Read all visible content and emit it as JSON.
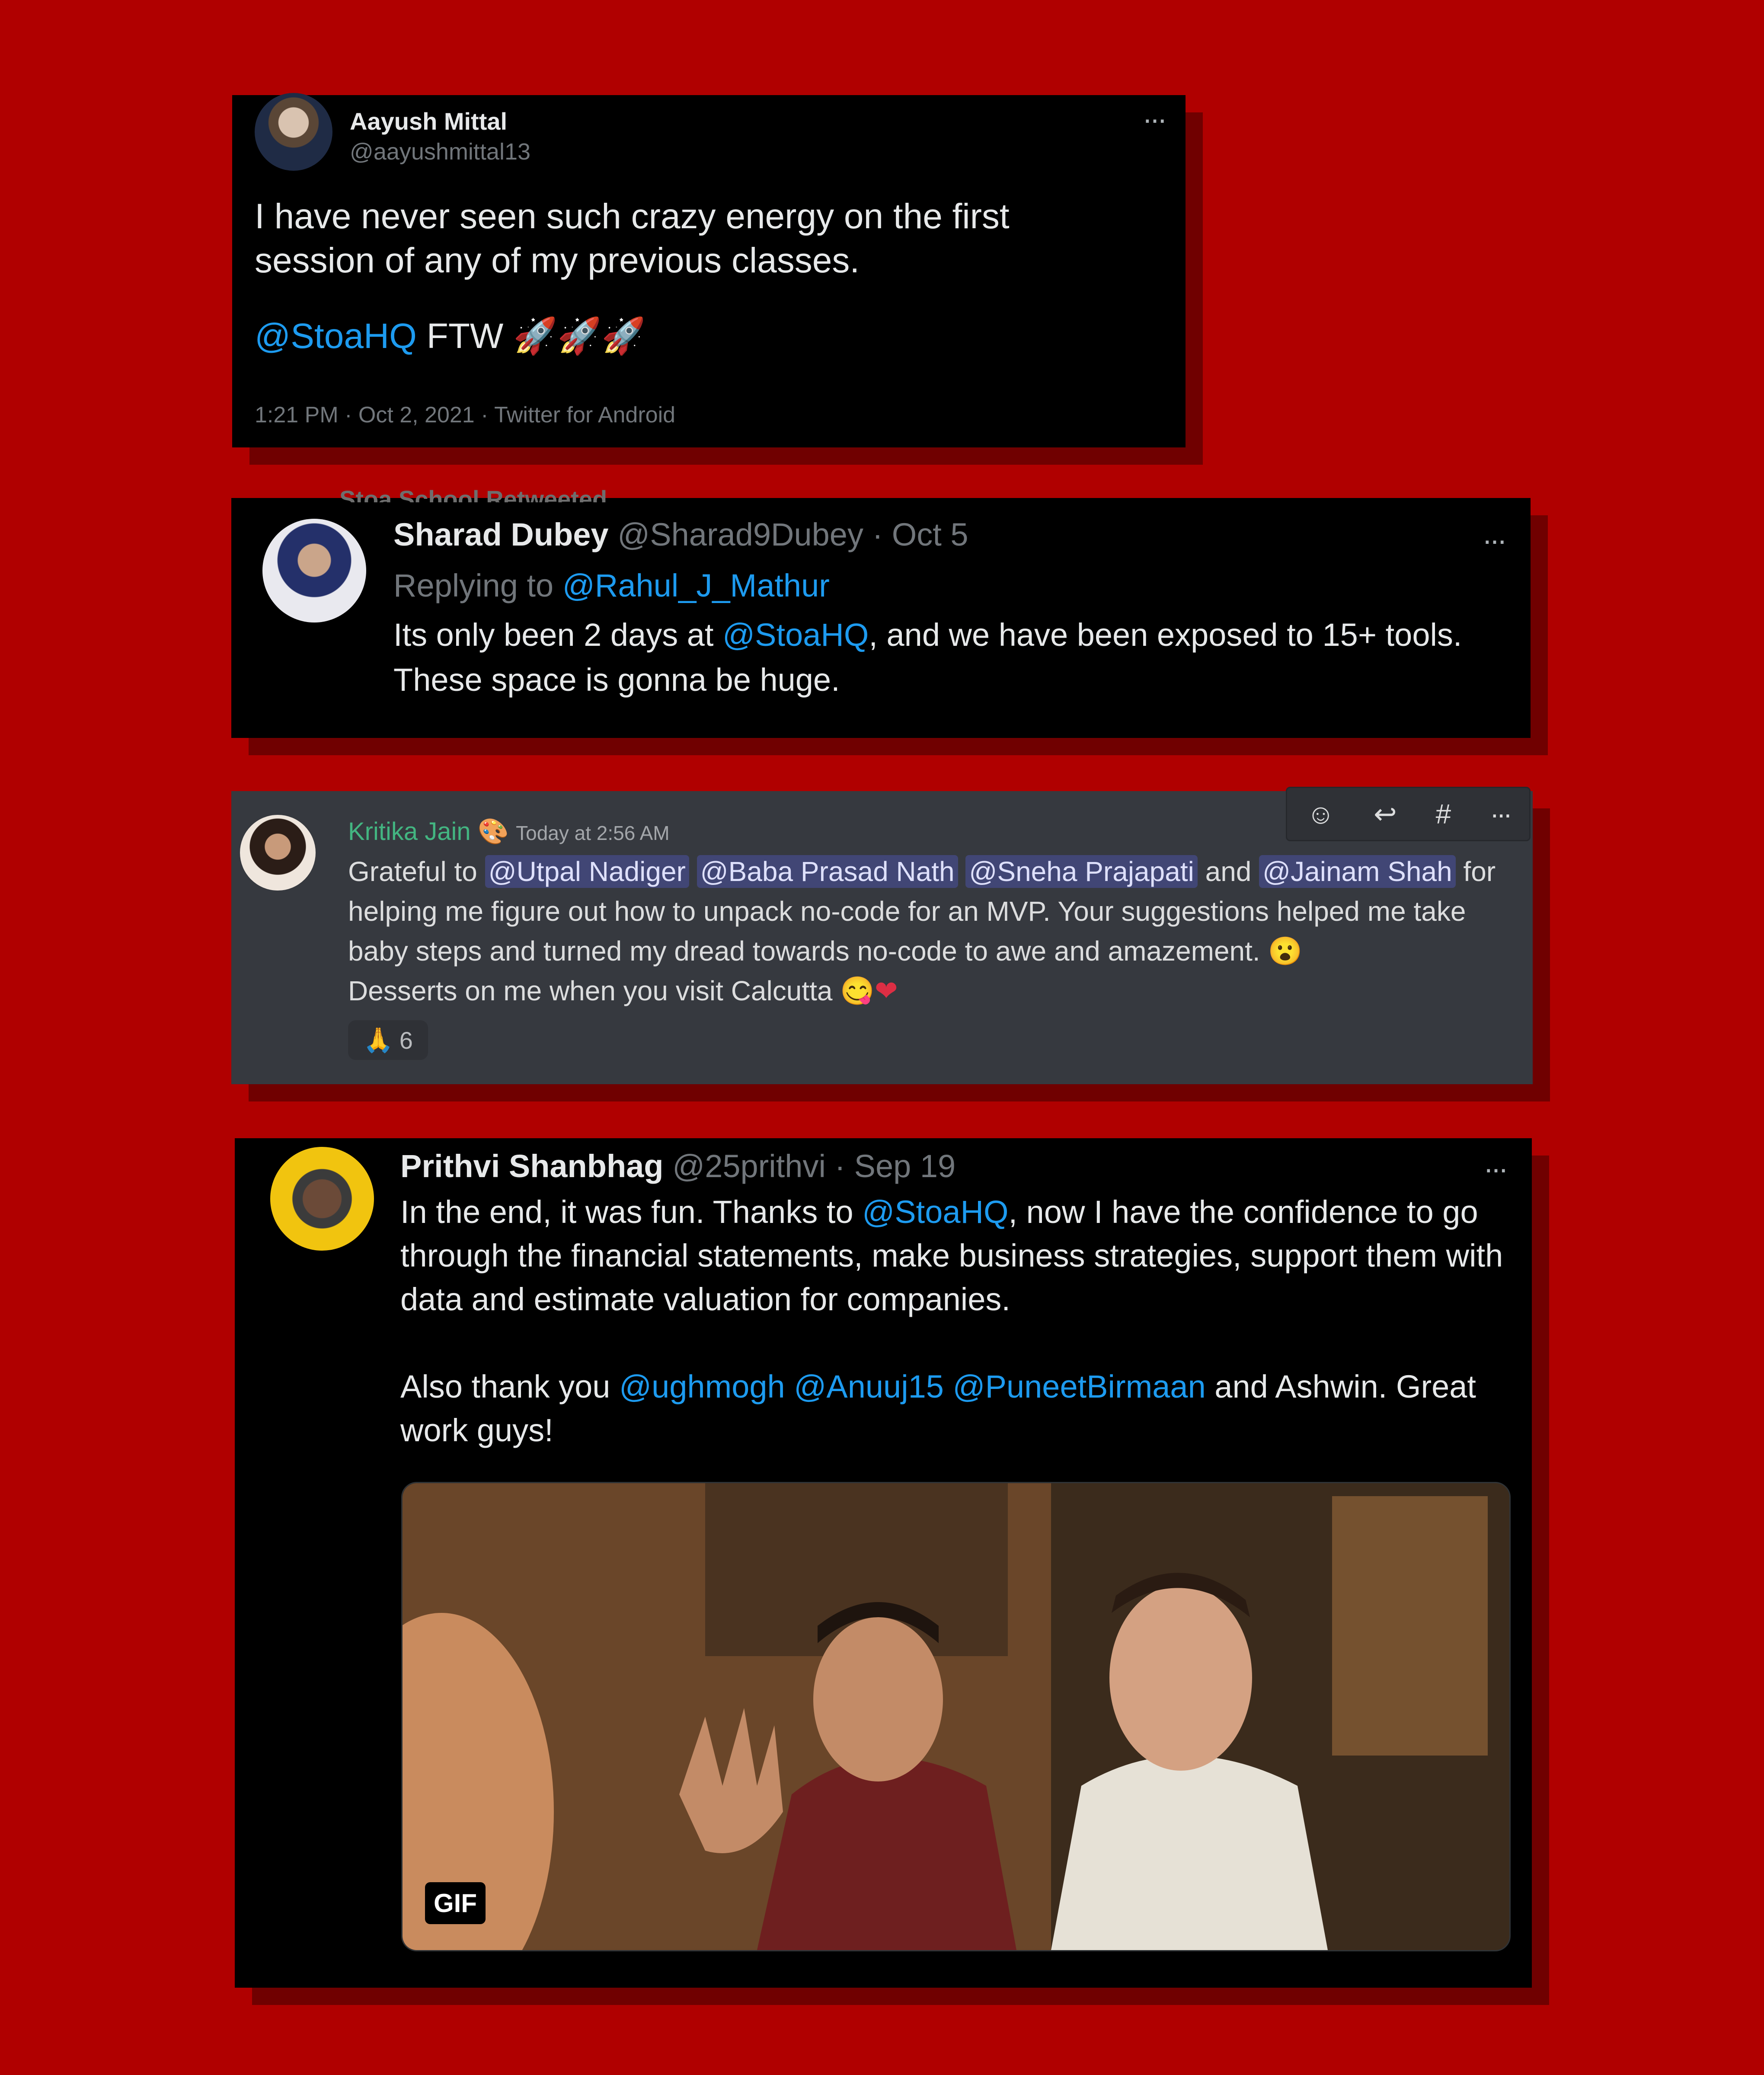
{
  "colors": {
    "background": "#b00000",
    "twitter_blue": "#1d9bf0",
    "discord_bg": "#36393f",
    "discord_green": "#43b581"
  },
  "tweet1": {
    "name": "Aayush Mittal",
    "handle": "@aayushmittal13",
    "text": "I have never seen such crazy energy on the first session of any of my previous classes.",
    "mention": "@StoaHQ",
    "after_mention": "FTW",
    "emoji": "rocket-icon",
    "meta": "1:21 PM · Oct 2, 2021 · Twitter for Android"
  },
  "tweet2": {
    "retweet_banner": "Stoa School Retweeted",
    "name": "Sharad Dubey",
    "handle": "@Sharad9Dubey",
    "date": "· Oct 5",
    "replying_to_label": "Replying to",
    "replying_to": "@Rahul_J_Mathur",
    "text_a": "Its only been 2 days at",
    "mention": "@StoaHQ",
    "text_b": ", and we have been exposed to 15+ tools. These space is gonna be huge."
  },
  "discord": {
    "name": "Kritika Jain",
    "timestamp": "Today at 2:56 AM",
    "text_a": "Grateful to",
    "mentions": [
      "@Utpal Nadiger",
      "@Baba Prasad Nath",
      "@Sneha Prajapati",
      "@Jainam Shah"
    ],
    "and": "and",
    "text_b": "for helping me figure out how to unpack no-code for an MVP. Your suggestions helped me take baby steps and turned my dread towards no-code to awe and amazement.",
    "text_c": "Desserts on me when you visit Calcutta",
    "reaction_count": "6",
    "toolbar_icons": [
      "add-reaction-icon",
      "reply-icon",
      "create-thread-icon",
      "more-icon"
    ]
  },
  "tweet3": {
    "name": "Prithvi Shanbhag",
    "handle": "@25prithvi",
    "date": "· Sep 19",
    "p1_a": "In the end, it was fun. Thanks to",
    "mention": "@StoaHQ",
    "p1_b": ", now I have the confidence to go through the financial statements, make business strategies, support them with data and estimate valuation for companies.",
    "p2_a": "Also thank you",
    "mentions": [
      "@ughmogh",
      "@Anuuj15",
      "@PuneetBirmaan"
    ],
    "p2_b": "and Ashwin. Great work guys!",
    "gif_label": "GIF"
  }
}
